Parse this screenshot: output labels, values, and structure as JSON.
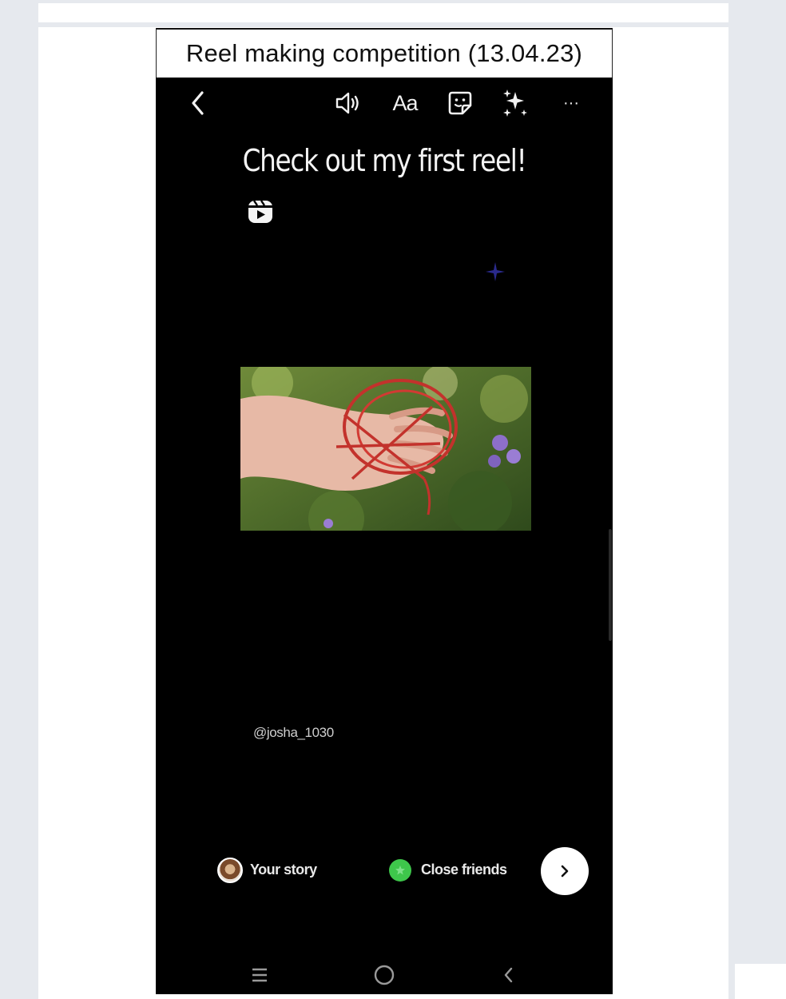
{
  "document": {
    "caption": "Reel making competition (13.04.23)"
  },
  "story_editor": {
    "toolbar": {
      "back_icon": "chevron-left-icon",
      "sound_icon": "speaker-icon",
      "text_tool_label": "Aa",
      "sticker_icon": "sticker-icon",
      "effects_icon": "sparkles-icon",
      "more_label": "···"
    },
    "headline": "Check out my first reel!",
    "reel_sticker_icon": "reels-icon",
    "mention": "@josha_1030",
    "share": {
      "your_story_label": "Your story",
      "close_friends_label": "Close friends",
      "close_friends_color": "#3ec74b",
      "next_icon": "chevron-right-icon"
    },
    "system_nav": {
      "recents_icon": "recents-icon",
      "home_icon": "home-circle-icon",
      "back_icon": "chevron-left-icon"
    }
  }
}
